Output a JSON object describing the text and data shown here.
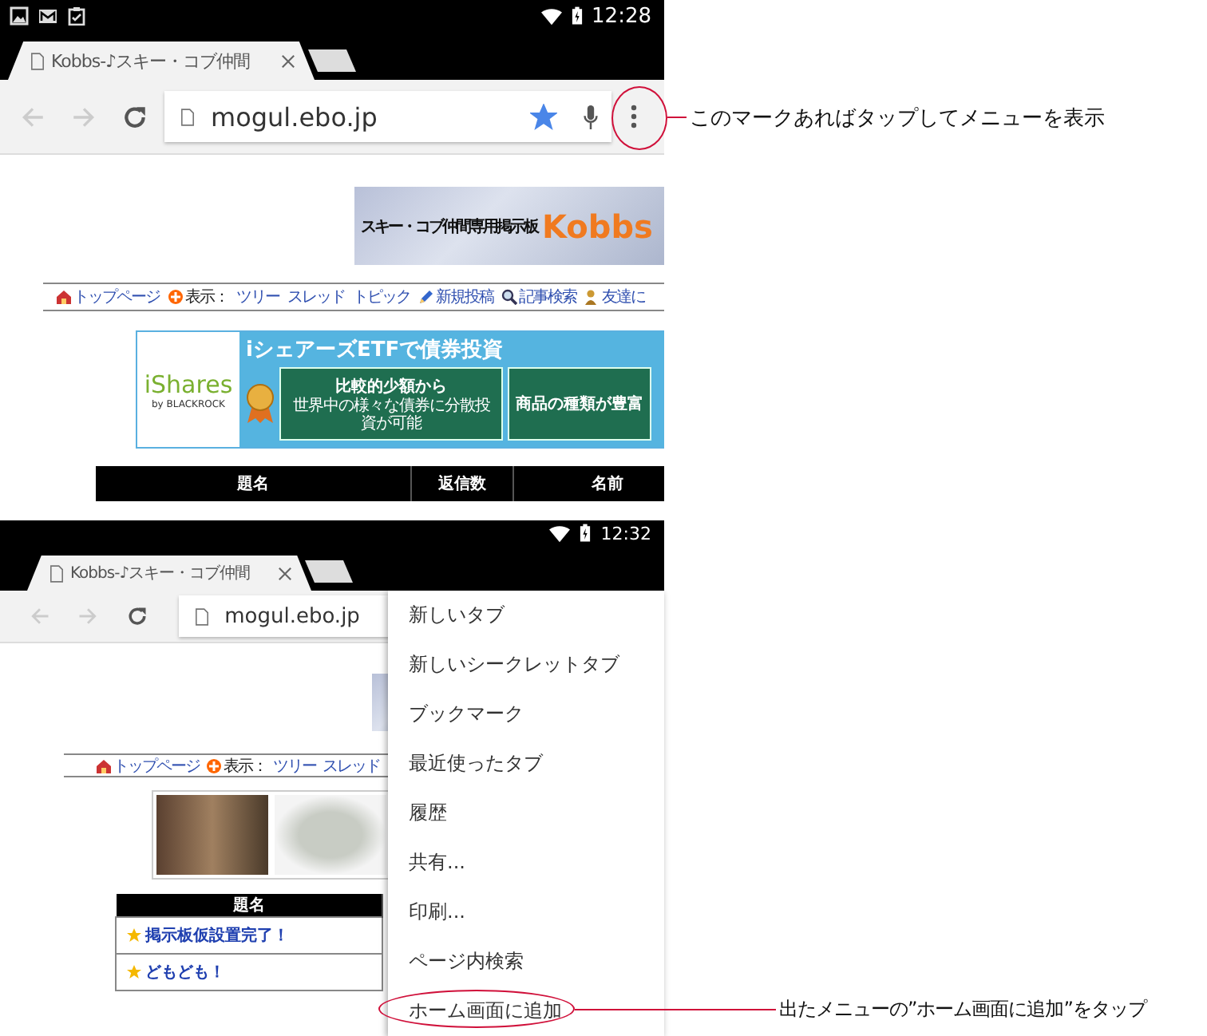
{
  "screens": [
    {
      "status_bar": {
        "time": "12:28"
      },
      "tab": {
        "title": "Kobbs-♪スキー・コブ仲間"
      },
      "toolbar": {
        "back_disabled": true,
        "forward_disabled": true,
        "url": "mogul.ebo.jp",
        "bookmarked": true,
        "menu_circled": true
      },
      "page": {
        "banner": {
          "caption": "スキー・コブ仲間専用掲示板",
          "logo": "Kobbs"
        },
        "nav": [
          {
            "kind": "link",
            "label": "トップページ"
          },
          {
            "kind": "label",
            "label": "表示："
          },
          {
            "kind": "link",
            "label": "ツリー"
          },
          {
            "kind": "link",
            "label": "スレッド"
          },
          {
            "kind": "link",
            "label": "トピック"
          },
          {
            "kind": "link",
            "label": "新規投稿"
          },
          {
            "kind": "link",
            "label": "記事検索"
          },
          {
            "kind": "link",
            "label": "友達に"
          }
        ],
        "ad": {
          "kind": "ishares",
          "brand": "iShares",
          "brand_sub": "by BLACKROCK",
          "headline": "iシェアーズETFで債券投資",
          "features": [
            {
              "title": "比較的少額から",
              "subtitle": "世界中の様々な債券に分散投資が可能"
            },
            {
              "title": "商品の種類が豊富"
            }
          ]
        },
        "table": {
          "columns": [
            "題名",
            "返信数",
            "名前"
          ]
        }
      }
    },
    {
      "status_bar": {
        "time": "12:32"
      },
      "tab": {
        "title": "Kobbs-♪スキー・コブ仲間"
      },
      "toolbar": {
        "back_disabled": true,
        "forward_disabled": true,
        "url": "mogul.ebo.jp"
      },
      "page": {
        "nav": [
          {
            "kind": "link",
            "label": "トップページ"
          },
          {
            "kind": "label",
            "label": "表示："
          },
          {
            "kind": "link",
            "label": "ツリー"
          },
          {
            "kind": "link",
            "label": "スレッド"
          }
        ],
        "ad": {
          "kind": "photos"
        },
        "table": {
          "columns": [
            "題名"
          ],
          "rows": [
            "掲示板仮設置完了！",
            "どもども！"
          ]
        }
      },
      "menu": {
        "items": [
          {
            "label": "新しいタブ",
            "circled": false
          },
          {
            "label": "新しいシークレットタブ",
            "circled": false
          },
          {
            "label": "ブックマーク",
            "circled": false
          },
          {
            "label": "最近使ったタブ",
            "circled": false
          },
          {
            "label": "履歴",
            "circled": false
          },
          {
            "label": "共有...",
            "circled": false
          },
          {
            "label": "印刷...",
            "circled": false
          },
          {
            "label": "ページ内検索",
            "circled": false
          },
          {
            "label": "ホーム画面に追加",
            "circled": true
          }
        ]
      }
    }
  ],
  "callouts": [
    "このマークあればタップしてメニューを表示",
    "出たメニューの”ホーム画面に追加”をタップ"
  ]
}
